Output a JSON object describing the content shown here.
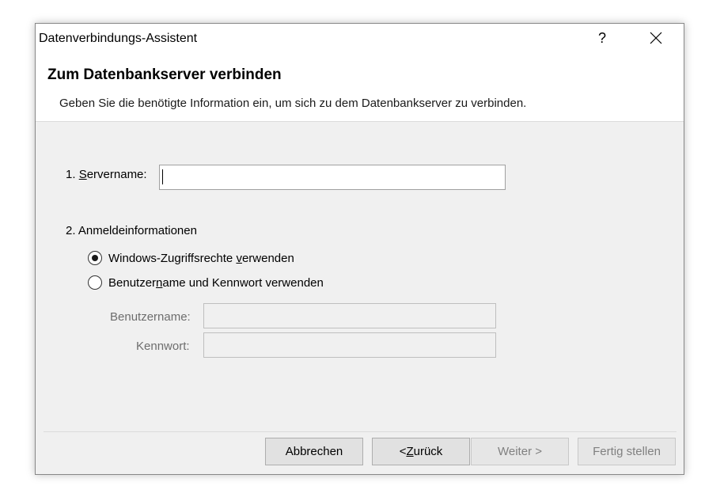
{
  "window": {
    "title": "Datenverbindungs-Assistent",
    "help_label": "?",
    "close_icon": "close-icon"
  },
  "header": {
    "title": "Zum Datenbankserver verbinden",
    "description": "Geben Sie die benötigte Information ein, um sich zu dem Datenbankserver zu verbinden."
  },
  "form": {
    "server": {
      "label_pre": "1. ",
      "label_accel": "S",
      "label_post": "ervername:",
      "value": ""
    },
    "credentials": {
      "heading": "2. Anmeldeinformationen",
      "option_windows": {
        "pre": "Windows-Zugriffsrechte ",
        "accel": "v",
        "post": "erwenden",
        "checked": true
      },
      "option_userpass": {
        "pre": "Benutzer",
        "accel": "n",
        "post": "ame und Kennwort verwenden",
        "checked": false
      },
      "username_label": "Benutzername:",
      "username_value": "",
      "password_label": "Kennwort:",
      "password_value": ""
    }
  },
  "buttons": {
    "cancel": "Abbrechen",
    "back_pre": "< ",
    "back_accel": "Z",
    "back_post": "urück",
    "next": "Weiter >",
    "finish": "Fertig stellen"
  }
}
